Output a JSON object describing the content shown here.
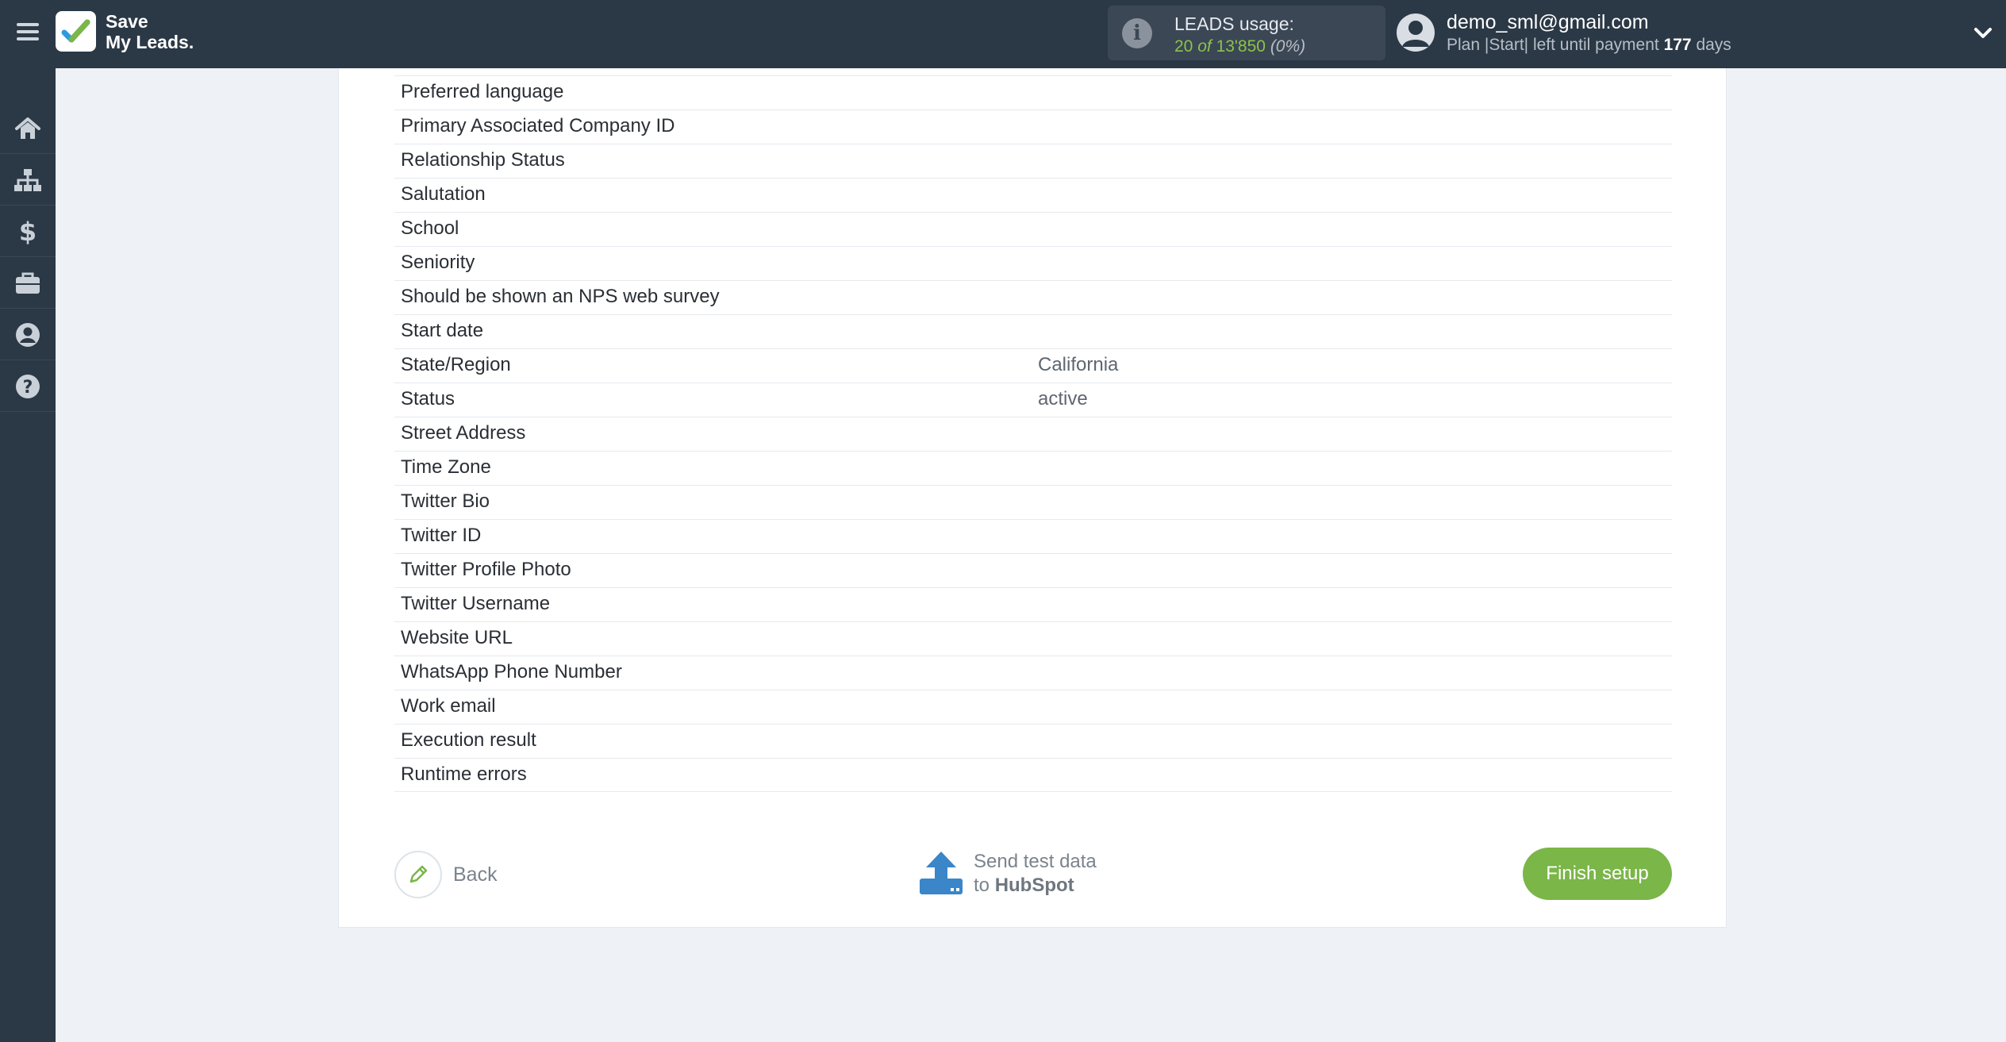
{
  "header": {
    "logo_line1": "Save",
    "logo_line2": "My Leads.",
    "usage_title": "LEADS usage:",
    "usage_used": "20",
    "usage_of": "of",
    "usage_total": "13'850",
    "usage_pct": "(0%)",
    "user_email": "demo_sml@gmail.com",
    "plan_prefix": "Plan |Start| left until payment",
    "plan_days": "177",
    "plan_suffix": "days"
  },
  "sidebar": {
    "items": [
      {
        "name": "home-icon"
      },
      {
        "name": "sitemap-icon"
      },
      {
        "name": "dollar-icon"
      },
      {
        "name": "briefcase-icon"
      },
      {
        "name": "user-circle-icon"
      },
      {
        "name": "help-icon"
      }
    ]
  },
  "fields": [
    {
      "name": "Preferred language",
      "value": ""
    },
    {
      "name": "Primary Associated Company ID",
      "value": ""
    },
    {
      "name": "Relationship Status",
      "value": ""
    },
    {
      "name": "Salutation",
      "value": ""
    },
    {
      "name": "School",
      "value": ""
    },
    {
      "name": "Seniority",
      "value": ""
    },
    {
      "name": "Should be shown an NPS web survey",
      "value": ""
    },
    {
      "name": "Start date",
      "value": ""
    },
    {
      "name": "State/Region",
      "value": "California"
    },
    {
      "name": "Status",
      "value": "active"
    },
    {
      "name": "Street Address",
      "value": ""
    },
    {
      "name": "Time Zone",
      "value": ""
    },
    {
      "name": "Twitter Bio",
      "value": ""
    },
    {
      "name": "Twitter ID",
      "value": ""
    },
    {
      "name": "Twitter Profile Photo",
      "value": ""
    },
    {
      "name": "Twitter Username",
      "value": ""
    },
    {
      "name": "Website URL",
      "value": ""
    },
    {
      "name": "WhatsApp Phone Number",
      "value": ""
    },
    {
      "name": "Work email",
      "value": ""
    },
    {
      "name": "Execution result",
      "value": ""
    },
    {
      "name": "Runtime errors",
      "value": ""
    }
  ],
  "footer": {
    "back_label": "Back",
    "send_line1": "Send test data",
    "send_to": "to",
    "send_service": "HubSpot",
    "finish_label": "Finish setup"
  },
  "colors": {
    "topbar": "#2b3846",
    "accent_green": "#7ab648",
    "upload_blue": "#3a86c8"
  }
}
